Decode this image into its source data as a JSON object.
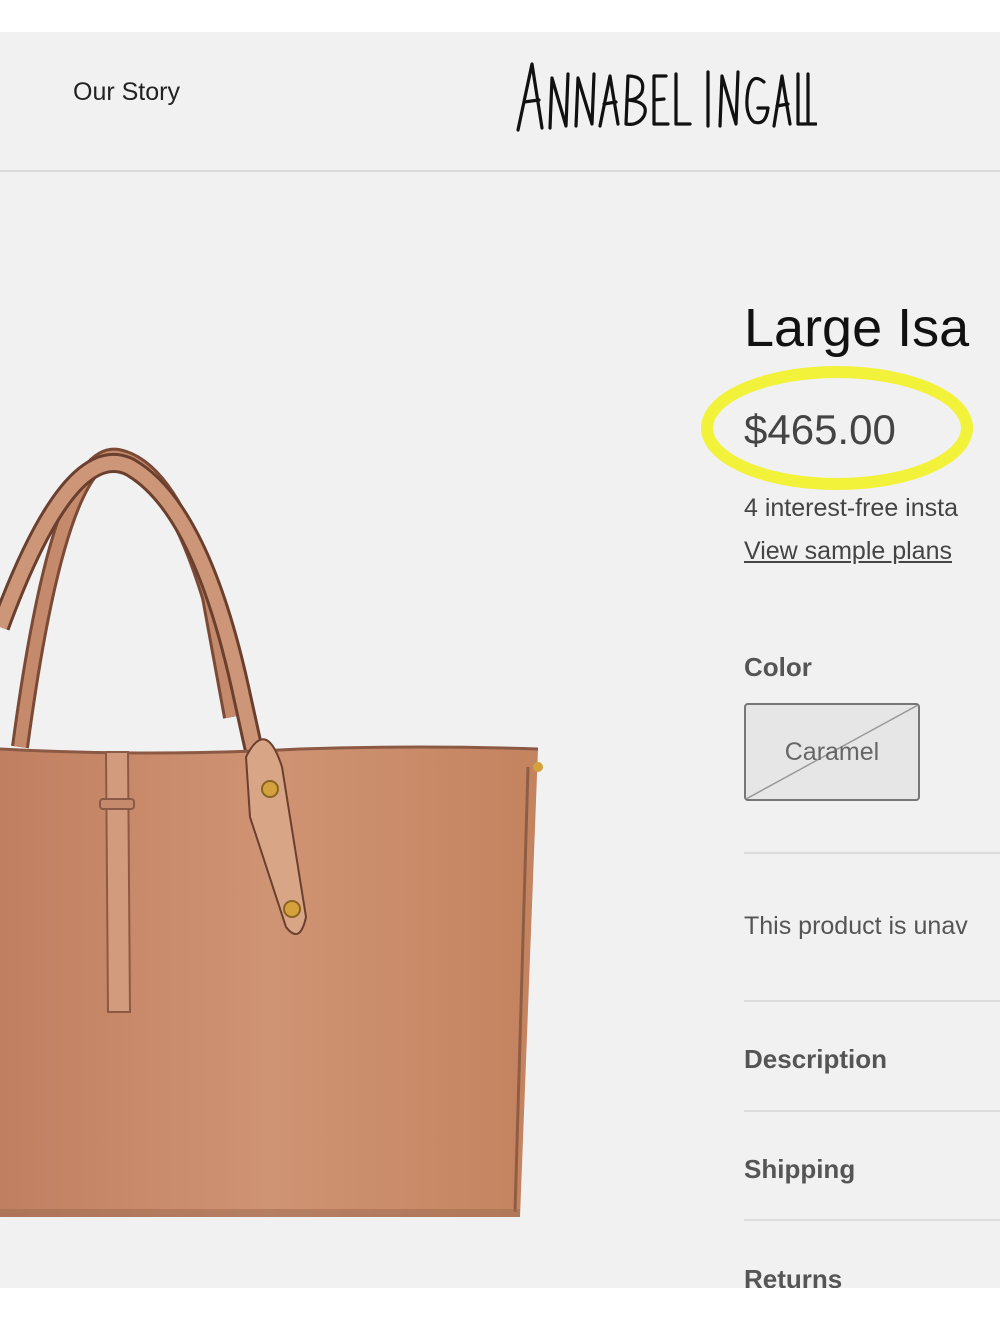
{
  "header": {
    "nav_link": "Our Story",
    "logo_text": "ANNABEL INGALL"
  },
  "product": {
    "title": "Large Isa",
    "price": "$465.00",
    "installments_text": "4 interest-free insta",
    "sample_plans_link": "View sample plans",
    "color_label": "Color",
    "selected_color": "Caramel",
    "availability_text": "This product is unav",
    "accordion_items": [
      "Description",
      "Shipping",
      "Returns"
    ]
  },
  "colors": {
    "highlight": "#f2f23a",
    "leather": "#c9896a"
  }
}
